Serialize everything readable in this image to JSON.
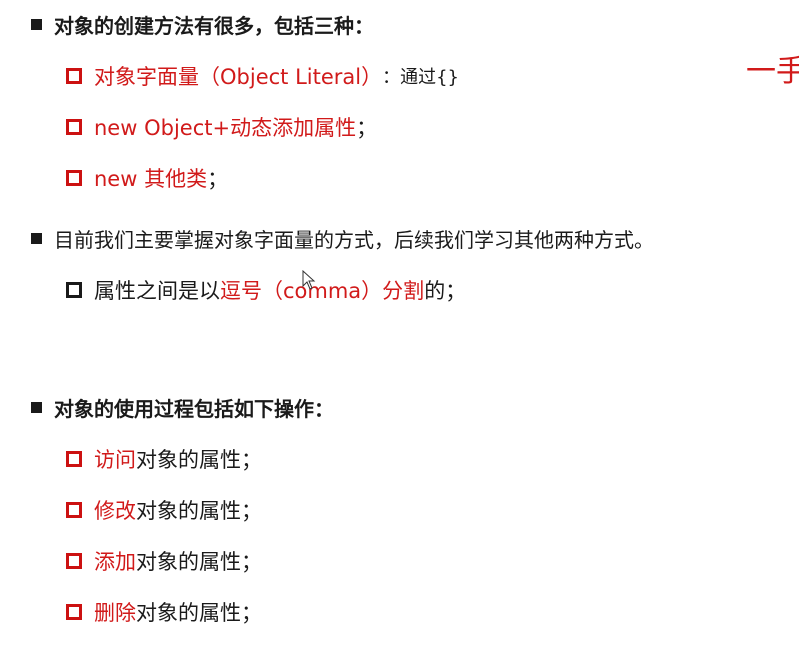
{
  "section1": {
    "title": "对象的创建方法有很多，包括三种：",
    "items": [
      {
        "red": "对象字面量（Object Literal）",
        "rest": "：通过{}"
      },
      {
        "red": "new Object+动态添加属性",
        "rest": "；"
      },
      {
        "red": "new 其他类",
        "rest": "；"
      }
    ]
  },
  "section2": {
    "title": "目前我们主要掌握对象字面量的方式，后续我们学习其他两种方式。",
    "item": {
      "pre": "属性之间是以",
      "red": "逗号（comma）分割",
      "post": "的；"
    }
  },
  "section3": {
    "title": "对象的使用过程包括如下操作：",
    "items": [
      {
        "red": "访问",
        "rest": "对象的属性；"
      },
      {
        "red": "修改",
        "rest": "对象的属性；"
      },
      {
        "red": "添加",
        "rest": "对象的属性；"
      },
      {
        "red": "删除",
        "rest": "对象的属性；"
      }
    ]
  },
  "corner_text": "一手",
  "colors": {
    "accent_red": "#d11a1a",
    "text": "#1a1a1a"
  }
}
